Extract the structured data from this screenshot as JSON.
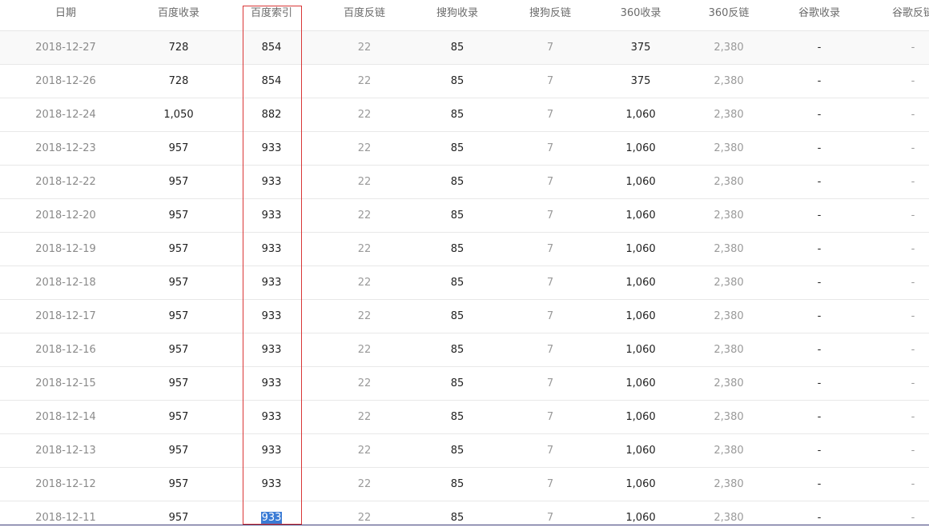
{
  "table": {
    "headers": [
      "日期",
      "百度收录",
      "百度索引",
      "百度反链",
      "搜狗收录",
      "搜狗反链",
      "360收录",
      "360反链",
      "谷歌收录",
      "谷歌反链"
    ],
    "rows": [
      [
        "2018-12-27",
        "728",
        "854",
        "22",
        "85",
        "7",
        "375",
        "2,380",
        "-",
        "-"
      ],
      [
        "2018-12-26",
        "728",
        "854",
        "22",
        "85",
        "7",
        "375",
        "2,380",
        "-",
        "-"
      ],
      [
        "2018-12-24",
        "1,050",
        "882",
        "22",
        "85",
        "7",
        "1,060",
        "2,380",
        "-",
        "-"
      ],
      [
        "2018-12-23",
        "957",
        "933",
        "22",
        "85",
        "7",
        "1,060",
        "2,380",
        "-",
        "-"
      ],
      [
        "2018-12-22",
        "957",
        "933",
        "22",
        "85",
        "7",
        "1,060",
        "2,380",
        "-",
        "-"
      ],
      [
        "2018-12-20",
        "957",
        "933",
        "22",
        "85",
        "7",
        "1,060",
        "2,380",
        "-",
        "-"
      ],
      [
        "2018-12-19",
        "957",
        "933",
        "22",
        "85",
        "7",
        "1,060",
        "2,380",
        "-",
        "-"
      ],
      [
        "2018-12-18",
        "957",
        "933",
        "22",
        "85",
        "7",
        "1,060",
        "2,380",
        "-",
        "-"
      ],
      [
        "2018-12-17",
        "957",
        "933",
        "22",
        "85",
        "7",
        "1,060",
        "2,380",
        "-",
        "-"
      ],
      [
        "2018-12-16",
        "957",
        "933",
        "22",
        "85",
        "7",
        "1,060",
        "2,380",
        "-",
        "-"
      ],
      [
        "2018-12-15",
        "957",
        "933",
        "22",
        "85",
        "7",
        "1,060",
        "2,380",
        "-",
        "-"
      ],
      [
        "2018-12-14",
        "957",
        "933",
        "22",
        "85",
        "7",
        "1,060",
        "2,380",
        "-",
        "-"
      ],
      [
        "2018-12-13",
        "957",
        "933",
        "22",
        "85",
        "7",
        "1,060",
        "2,380",
        "-",
        "-"
      ],
      [
        "2018-12-12",
        "957",
        "933",
        "22",
        "85",
        "7",
        "1,060",
        "2,380",
        "-",
        "-"
      ],
      [
        "2018-12-11",
        "957",
        "933",
        "22",
        "85",
        "7",
        "1,060",
        "2,380",
        "-",
        "-"
      ]
    ]
  },
  "colors": {
    "highlight_border": "#d93636",
    "selection_bg": "#3a7bd5",
    "header_text": "#6b6b6b",
    "muted_text": "#9a9a9a"
  }
}
